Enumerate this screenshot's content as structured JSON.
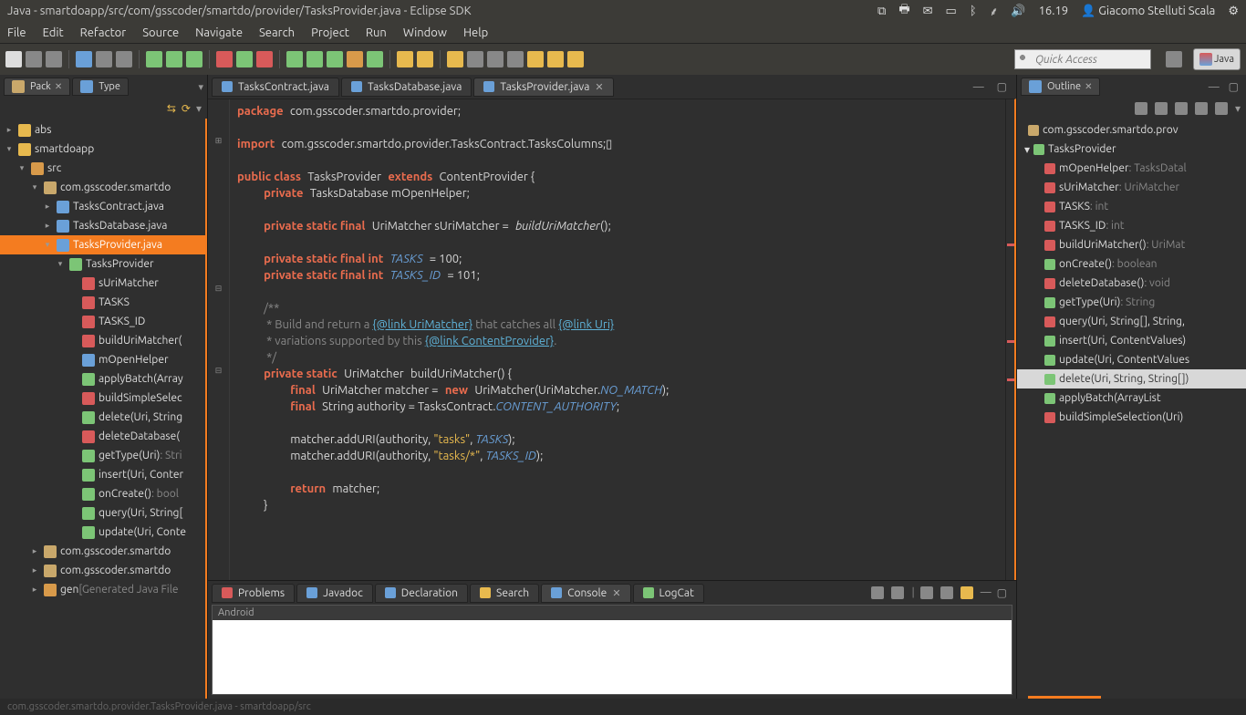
{
  "titlebar": {
    "title": "Java - smartdoapp/src/com/gsscoder/smartdo/provider/TasksProvider.java - Eclipse SDK",
    "time": "16.19",
    "user": "Giacomo Stelluti Scala"
  },
  "menu": [
    "File",
    "Edit",
    "Refactor",
    "Source",
    "Navigate",
    "Search",
    "Project",
    "Run",
    "Window",
    "Help"
  ],
  "quickAccess": {
    "placeholder": "Quick Access"
  },
  "perspective": "Java",
  "leftTabs": {
    "pack": "Pack",
    "type": "Type"
  },
  "tree": [
    {
      "d": 0,
      "a": "▸",
      "i": "#e7b94e",
      "t": "abs"
    },
    {
      "d": 0,
      "a": "▾",
      "i": "#e7b94e",
      "t": "smartdoapp"
    },
    {
      "d": 1,
      "a": "▾",
      "i": "#d89a4a",
      "t": "src"
    },
    {
      "d": 2,
      "a": "▾",
      "i": "#c9a86b",
      "t": "com.gsscoder.smartdo"
    },
    {
      "d": 3,
      "a": "▸",
      "i": "#6aa0d8",
      "t": "TasksContract.java"
    },
    {
      "d": 3,
      "a": "▸",
      "i": "#6aa0d8",
      "t": "TasksDatabase.java"
    },
    {
      "d": 3,
      "a": "▾",
      "i": "#6aa0d8",
      "t": "TasksProvider.java",
      "sel": true
    },
    {
      "d": 4,
      "a": "▾",
      "i": "#7cc576",
      "t": "TasksProvider"
    },
    {
      "d": 5,
      "a": "",
      "i": "#d85a5a",
      "t": "sUriMatcher"
    },
    {
      "d": 5,
      "a": "",
      "i": "#d85a5a",
      "t": "TASKS"
    },
    {
      "d": 5,
      "a": "",
      "i": "#d85a5a",
      "t": "TASKS_ID"
    },
    {
      "d": 5,
      "a": "",
      "i": "#d85a5a",
      "t": "buildUriMatcher("
    },
    {
      "d": 5,
      "a": "",
      "i": "#6aa0d8",
      "t": "mOpenHelper"
    },
    {
      "d": 5,
      "a": "",
      "i": "#7cc576",
      "t": "applyBatch(Array"
    },
    {
      "d": 5,
      "a": "",
      "i": "#d85a5a",
      "t": "buildSimpleSelec"
    },
    {
      "d": 5,
      "a": "",
      "i": "#7cc576",
      "t": "delete(Uri, String"
    },
    {
      "d": 5,
      "a": "",
      "i": "#d85a5a",
      "t": "deleteDatabase("
    },
    {
      "d": 5,
      "a": "",
      "i": "#7cc576",
      "t": "getType(Uri)",
      "h": ": Stri"
    },
    {
      "d": 5,
      "a": "",
      "i": "#7cc576",
      "t": "insert(Uri, Conter"
    },
    {
      "d": 5,
      "a": "",
      "i": "#7cc576",
      "t": "onCreate()",
      "h": ": bool"
    },
    {
      "d": 5,
      "a": "",
      "i": "#7cc576",
      "t": "query(Uri, String["
    },
    {
      "d": 5,
      "a": "",
      "i": "#7cc576",
      "t": "update(Uri, Conte"
    },
    {
      "d": 2,
      "a": "▸",
      "i": "#c9a86b",
      "t": "com.gsscoder.smartdo"
    },
    {
      "d": 2,
      "a": "▸",
      "i": "#c9a86b",
      "t": "com.gsscoder.smartdo"
    },
    {
      "d": 2,
      "a": "▸",
      "i": "#d89a4a",
      "t": "gen",
      "h": " [Generated Java File"
    }
  ],
  "editorTabs": [
    {
      "t": "TasksContract.java",
      "active": false
    },
    {
      "t": "TasksDatabase.java",
      "active": false
    },
    {
      "t": "TasksProvider.java",
      "active": true
    }
  ],
  "outlineTitle": "Outline",
  "outline": [
    {
      "d": 0,
      "a": "",
      "i": "#c9a86b",
      "t": "com.gsscoder.smartdo.prov"
    },
    {
      "d": 0,
      "a": "▾",
      "i": "#7cc576",
      "t": "TasksProvider"
    },
    {
      "d": 1,
      "a": "",
      "i": "#d85a5a",
      "t": "mOpenHelper",
      "h": " : TasksDatal"
    },
    {
      "d": 1,
      "a": "",
      "i": "#d85a5a",
      "t": "sUriMatcher",
      "h": " : UriMatcher"
    },
    {
      "d": 1,
      "a": "",
      "i": "#d85a5a",
      "t": "TASKS",
      "h": " : int"
    },
    {
      "d": 1,
      "a": "",
      "i": "#d85a5a",
      "t": "TASKS_ID",
      "h": " : int"
    },
    {
      "d": 1,
      "a": "",
      "i": "#d85a5a",
      "t": "buildUriMatcher()",
      "h": " : UriMat"
    },
    {
      "d": 1,
      "a": "",
      "i": "#7cc576",
      "t": "onCreate()",
      "h": " : boolean"
    },
    {
      "d": 1,
      "a": "",
      "i": "#d85a5a",
      "t": "deleteDatabase()",
      "h": " : void"
    },
    {
      "d": 1,
      "a": "",
      "i": "#7cc576",
      "t": "getType(Uri)",
      "h": " : String"
    },
    {
      "d": 1,
      "a": "",
      "i": "#d85a5a",
      "t": "query(Uri, String[], String,"
    },
    {
      "d": 1,
      "a": "",
      "i": "#7cc576",
      "t": "insert(Uri, ContentValues)"
    },
    {
      "d": 1,
      "a": "",
      "i": "#7cc576",
      "t": "update(Uri, ContentValues"
    },
    {
      "d": 1,
      "a": "",
      "i": "#7cc576",
      "t": "delete(Uri, String, String[])",
      "sel": true
    },
    {
      "d": 1,
      "a": "",
      "i": "#7cc576",
      "t": "applyBatch(ArrayList<Con"
    },
    {
      "d": 1,
      "a": "",
      "i": "#d85a5a",
      "t": "buildSimpleSelection(Uri)"
    }
  ],
  "bottomTabs": [
    {
      "t": "Problems",
      "active": false,
      "i": "#d85a5a"
    },
    {
      "t": "Javadoc",
      "active": false,
      "i": "#6aa0d8"
    },
    {
      "t": "Declaration",
      "active": false,
      "i": "#6aa0d8"
    },
    {
      "t": "Search",
      "active": false,
      "i": "#e7b94e"
    },
    {
      "t": "Console",
      "active": true,
      "i": "#6aa0d8"
    },
    {
      "t": "LogCat",
      "active": false,
      "i": "#7cc576"
    }
  ],
  "consoleHeader": "Android",
  "statusbar": "com.gsscoder.smartdo.provider.TasksProvider.java - smartdoapp/src",
  "code": {
    "package": "package",
    "pkgval": "com.gsscoder.smartdo.provider;",
    "import": "import",
    "impval": "com.gsscoder.smartdo.provider.TasksContract.TasksColumns;",
    "l3a": "public class",
    "l3b": "TasksProvider",
    "l3c": "extends",
    "l3d": "ContentProvider {",
    "l4a": "private",
    "l4b": "TasksDatabase mOpenHelper;",
    "l5a": "private static final",
    "l5b": "UriMatcher sUriMatcher =",
    "l5c": "buildUriMatcher",
    "l5d": "();",
    "l6a": "private static final int",
    "l6b": "TASKS",
    "l6c": "= 100;",
    "l7a": "private static final int",
    "l7b": "TASKS_ID",
    "l7c": "= 101;",
    "c1": "/**",
    "c2": " * Build and return a ",
    "c2l": "{@link UriMatcher}",
    "c2b": " that catches all ",
    "c2l2": "{@link Uri}",
    "c3": " * variations supported by this ",
    "c3l": "{@link ContentProvider}",
    "c3b": ".",
    "c4": " */",
    "l8a": "private static",
    "l8b": "UriMatcher",
    "l8c": "buildUriMatcher() {",
    "l9a": "final",
    "l9b": "UriMatcher matcher =",
    "l9c": "new",
    "l9d": "UriMatcher(UriMatcher.",
    "l9e": "NO_MATCH",
    "l9f": ");",
    "l10a": "final",
    "l10b": "String authority = TasksContract.",
    "l10c": "CONTENT_AUTHORITY",
    "l10d": ";",
    "l11a": "matcher.addURI(authority, ",
    "l11b": "\"tasks\"",
    "l11c": ", ",
    "l11d": "TASKS",
    "l11e": ");",
    "l12a": "matcher.addURI(authority, ",
    "l12b": "\"tasks/*\"",
    "l12c": ", ",
    "l12d": "TASKS_ID",
    "l12e": ");",
    "l13a": "return",
    "l13b": "matcher;",
    "l14": "}"
  }
}
